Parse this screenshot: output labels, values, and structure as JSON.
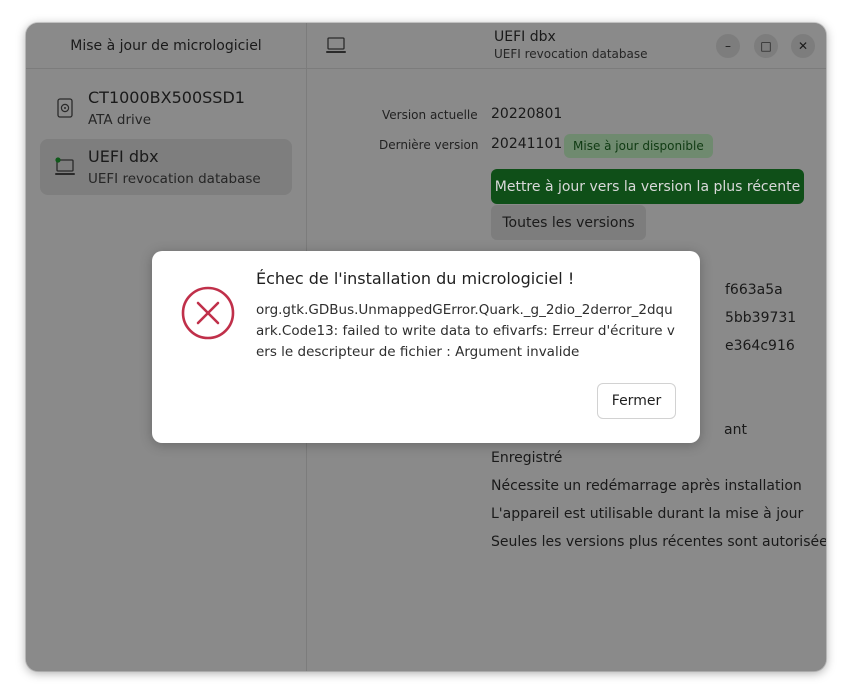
{
  "sidebar": {
    "title": "Mise à jour de micrologiciel",
    "devices": [
      {
        "name": "CT1000BX500SSD1",
        "subtitle": "ATA drive",
        "icon": "drive-icon"
      },
      {
        "name": "UEFI dbx",
        "subtitle": "UEFI revocation database",
        "icon": "computer-icon"
      }
    ]
  },
  "header": {
    "title": "UEFI dbx",
    "subtitle": "UEFI revocation database",
    "minimize": "–",
    "maximize": "□",
    "close": "✕"
  },
  "details": {
    "current_version_label": "Version actuelle",
    "current_version": "20220801",
    "latest_version_label": "Dernière version",
    "latest_version": "20241101",
    "update_badge": "Mise à jour disponible",
    "update_button": "Mettre à jour vers la version la plus récente",
    "all_versions_button": "Toutes les versions",
    "partial_values": [
      "f663a5a",
      "5bb39731",
      "e364c916",
      "ant"
    ],
    "flags": [
      "Enregistré",
      "Nécessite un redémarrage après installation",
      "L'appareil est utilisable durant la mise à jour",
      "Seules les versions plus récentes sont autorisées"
    ]
  },
  "dialog": {
    "title": "Échec de l'installation du micrologiciel !",
    "message": "org.gtk.GDBus.UnmappedGError.Quark._g_2dio_2derror_2dquark.Code13: failed to write data to efivarfs: Erreur d'écriture vers le descripteur de fichier : Argument invalide",
    "close_button": "Fermer"
  },
  "colors": {
    "error_icon": "#c0304a",
    "primary_button": "#0f4f18",
    "badge": "#6f8a6f"
  }
}
